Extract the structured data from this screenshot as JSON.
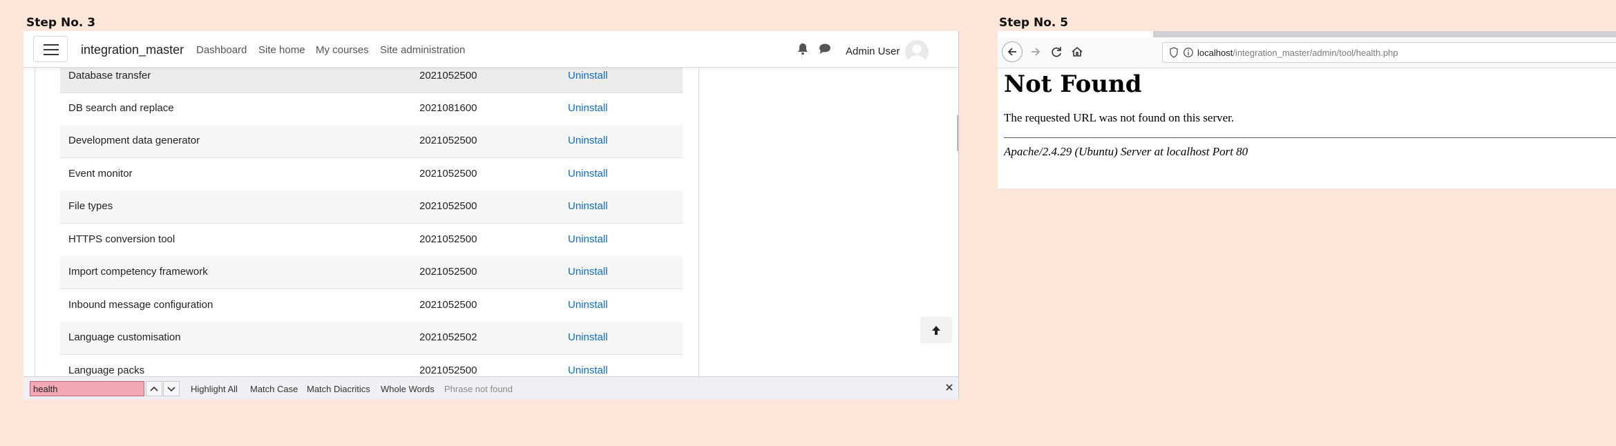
{
  "steps": {
    "left_label": "Step No. 3",
    "right_label": "Step No. 5"
  },
  "moodle": {
    "brand": "integration_master",
    "nav": [
      "Dashboard",
      "Site home",
      "My courses",
      "Site administration"
    ],
    "user_name": "Admin User",
    "rows": [
      {
        "name": "Database transfer",
        "version": "2021052500",
        "action": "Uninstall"
      },
      {
        "name": "DB search and replace",
        "version": "2021081600",
        "action": "Uninstall"
      },
      {
        "name": "Development data generator",
        "version": "2021052500",
        "action": "Uninstall"
      },
      {
        "name": "Event monitor",
        "version": "2021052500",
        "action": "Uninstall"
      },
      {
        "name": "File types",
        "version": "2021052500",
        "action": "Uninstall"
      },
      {
        "name": "HTTPS conversion tool",
        "version": "2021052500",
        "action": "Uninstall"
      },
      {
        "name": "Import competency framework",
        "version": "2021052500",
        "action": "Uninstall"
      },
      {
        "name": "Inbound message configuration",
        "version": "2021052500",
        "action": "Uninstall"
      },
      {
        "name": "Language customisation",
        "version": "2021052502",
        "action": "Uninstall"
      },
      {
        "name": "Language packs",
        "version": "2021052500",
        "action": "Uninstall"
      }
    ],
    "link_color": "#0f6cbf"
  },
  "findbar": {
    "query": "health",
    "options": [
      "Highlight All",
      "Match Case",
      "Match Diacritics",
      "Whole Words"
    ],
    "status": "Phrase not found"
  },
  "browser": {
    "url_host": "localhost",
    "url_path": "/integration_master/admin/tool/health.php",
    "page_title": "Not Found",
    "message": "The requested URL was not found on this server.",
    "server_signature": "Apache/2.4.29 (Ubuntu) Server at localhost Port 80"
  }
}
